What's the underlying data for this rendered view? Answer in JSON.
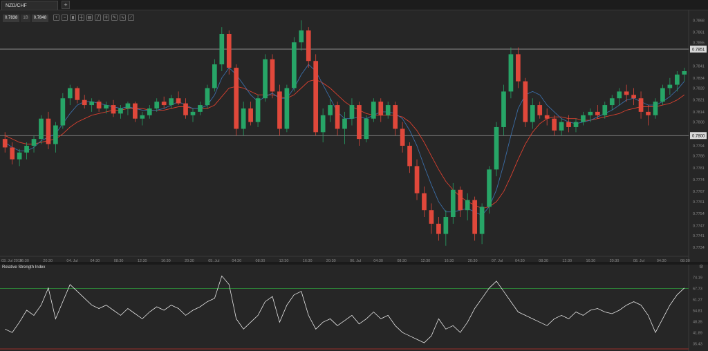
{
  "tab": {
    "label": "NZD/CHF",
    "add_label": "+"
  },
  "quote": {
    "bid": "0.7838",
    "mid": "1B",
    "ask": "0.7848"
  },
  "toolbar": {
    "icons": [
      "zoom-in-icon",
      "zoom-out-icon",
      "candles-icon",
      "ohlc-icon",
      "bars-icon",
      "line-icon",
      "crosshair-icon",
      "pencil-icon",
      "indicator-icon",
      "draw-icon"
    ]
  },
  "rsi": {
    "title": "Relative Strength Index",
    "gear": "⚙"
  },
  "colors": {
    "up": "#27a567",
    "down": "#e0483b",
    "sma_fast": "#3b6ea8",
    "sma_slow": "#d9402f",
    "rsi_line": "#e8e8e8",
    "rsi_upper": "#2e8b3a",
    "rsi_lower": "#c9302c",
    "hline": "#9a9a9a"
  },
  "chart_data": [
    {
      "type": "candlestick",
      "title": "NZD/CHF",
      "ylim": [
        0.773,
        0.7871
      ],
      "y_ticks": [
        "0.7868",
        "0.7861",
        "0.7855",
        "0.7851",
        "0.7841",
        "0.7834",
        "0.7828",
        "0.7821",
        "0.7814",
        "0.7808",
        "0.7800",
        "0.7794",
        "0.7788",
        "0.7781",
        "0.7774",
        "0.7767",
        "0.7761",
        "0.7754",
        "0.7747",
        "0.7741",
        "0.7734"
      ],
      "x_ticks": [
        "03. Jul 2014",
        "16:30",
        "20:30",
        "04. Jul",
        "04:30",
        "08:30",
        "12:30",
        "16:30",
        "20:30",
        "05. Jul",
        "04:30",
        "08:30",
        "12:30",
        "16:30",
        "20:30",
        "06. Jul",
        "04:30",
        "08:30",
        "12:30",
        "16:30",
        "20:30",
        "07. Jul",
        "04:30",
        "08:30",
        "12:30",
        "16:30",
        "20:30",
        "08. Jul",
        "04:30",
        "08:30"
      ],
      "horizontal_lines": [
        {
          "value": 0.7851,
          "label": "0.7851"
        },
        {
          "value": 0.78,
          "label": "0.7800"
        }
      ],
      "candles": [
        [
          0.7798,
          0.7802,
          0.779,
          0.7793
        ],
        [
          0.7793,
          0.7796,
          0.7783,
          0.7786
        ],
        [
          0.7786,
          0.7792,
          0.7782,
          0.779
        ],
        [
          0.779,
          0.7796,
          0.7786,
          0.7794
        ],
        [
          0.7794,
          0.78,
          0.779,
          0.7798
        ],
        [
          0.7798,
          0.7812,
          0.7795,
          0.781
        ],
        [
          0.781,
          0.7814,
          0.7792,
          0.7795
        ],
        [
          0.7795,
          0.7808,
          0.779,
          0.7806
        ],
        [
          0.7806,
          0.7825,
          0.7804,
          0.7822
        ],
        [
          0.7822,
          0.783,
          0.7818,
          0.7828
        ],
        [
          0.7828,
          0.7829,
          0.7819,
          0.7821
        ],
        [
          0.7821,
          0.7824,
          0.7816,
          0.7818
        ],
        [
          0.7818,
          0.7822,
          0.7814,
          0.782
        ],
        [
          0.782,
          0.7821,
          0.7814,
          0.7816
        ],
        [
          0.7816,
          0.782,
          0.7813,
          0.7818
        ],
        [
          0.7818,
          0.7821,
          0.7811,
          0.7813
        ],
        [
          0.7813,
          0.7818,
          0.781,
          0.7816
        ],
        [
          0.7816,
          0.782,
          0.7812,
          0.7819
        ],
        [
          0.7819,
          0.782,
          0.7808,
          0.781
        ],
        [
          0.781,
          0.7814,
          0.7806,
          0.7812
        ],
        [
          0.7812,
          0.7818,
          0.781,
          0.7816
        ],
        [
          0.7816,
          0.7822,
          0.7814,
          0.782
        ],
        [
          0.782,
          0.7823,
          0.7816,
          0.7818
        ],
        [
          0.7818,
          0.7824,
          0.7816,
          0.7822
        ],
        [
          0.7822,
          0.7826,
          0.7818,
          0.7819
        ],
        [
          0.7819,
          0.7822,
          0.781,
          0.7812
        ],
        [
          0.7812,
          0.7816,
          0.7808,
          0.7814
        ],
        [
          0.7814,
          0.782,
          0.7812,
          0.7818
        ],
        [
          0.7818,
          0.783,
          0.7816,
          0.7828
        ],
        [
          0.7828,
          0.7845,
          0.7826,
          0.7842
        ],
        [
          0.7842,
          0.7864,
          0.7838,
          0.786
        ],
        [
          0.786,
          0.7862,
          0.7836,
          0.784
        ],
        [
          0.784,
          0.7842,
          0.78,
          0.7804
        ],
        [
          0.7804,
          0.782,
          0.78,
          0.7816
        ],
        [
          0.7816,
          0.782,
          0.7806,
          0.7808
        ],
        [
          0.7808,
          0.7824,
          0.7805,
          0.7822
        ],
        [
          0.7822,
          0.7848,
          0.782,
          0.7845
        ],
        [
          0.7845,
          0.7848,
          0.7822,
          0.7826
        ],
        [
          0.7826,
          0.783,
          0.78,
          0.7804
        ],
        [
          0.7804,
          0.783,
          0.7802,
          0.7828
        ],
        [
          0.7828,
          0.7858,
          0.7826,
          0.7855
        ],
        [
          0.7855,
          0.7868,
          0.785,
          0.7862
        ],
        [
          0.7862,
          0.7864,
          0.784,
          0.7844
        ],
        [
          0.7844,
          0.7848,
          0.78,
          0.7802
        ],
        [
          0.7802,
          0.7816,
          0.7796,
          0.7812
        ],
        [
          0.7812,
          0.7822,
          0.7808,
          0.7818
        ],
        [
          0.7818,
          0.782,
          0.78,
          0.7804
        ],
        [
          0.7804,
          0.7814,
          0.7795,
          0.781
        ],
        [
          0.781,
          0.7822,
          0.7806,
          0.7818
        ],
        [
          0.7818,
          0.782,
          0.7794,
          0.7798
        ],
        [
          0.7798,
          0.7812,
          0.7796,
          0.781
        ],
        [
          0.781,
          0.7822,
          0.7808,
          0.782
        ],
        [
          0.782,
          0.7822,
          0.7808,
          0.7812
        ],
        [
          0.7812,
          0.782,
          0.781,
          0.7818
        ],
        [
          0.7818,
          0.782,
          0.78,
          0.7804
        ],
        [
          0.7804,
          0.7808,
          0.779,
          0.7794
        ],
        [
          0.7794,
          0.7796,
          0.7778,
          0.7782
        ],
        [
          0.7782,
          0.7786,
          0.7762,
          0.7766
        ],
        [
          0.7766,
          0.777,
          0.7752,
          0.7756
        ],
        [
          0.7756,
          0.776,
          0.7742,
          0.7748
        ],
        [
          0.7748,
          0.7752,
          0.7738,
          0.7742
        ],
        [
          0.7742,
          0.7756,
          0.7735,
          0.7752
        ],
        [
          0.7752,
          0.7772,
          0.7748,
          0.7768
        ],
        [
          0.7768,
          0.777,
          0.7752,
          0.7756
        ],
        [
          0.7756,
          0.7766,
          0.775,
          0.7762
        ],
        [
          0.7762,
          0.7764,
          0.7738,
          0.7742
        ],
        [
          0.7742,
          0.776,
          0.7736,
          0.7758
        ],
        [
          0.7758,
          0.7782,
          0.7754,
          0.778
        ],
        [
          0.778,
          0.7808,
          0.7776,
          0.7805
        ],
        [
          0.7805,
          0.783,
          0.78,
          0.7826
        ],
        [
          0.7826,
          0.7852,
          0.7822,
          0.7848
        ],
        [
          0.7848,
          0.7852,
          0.7828,
          0.7832
        ],
        [
          0.7832,
          0.7834,
          0.7805,
          0.7808
        ],
        [
          0.7808,
          0.7822,
          0.7804,
          0.7818
        ],
        [
          0.7818,
          0.782,
          0.781,
          0.7812
        ],
        [
          0.7812,
          0.7816,
          0.7806,
          0.781
        ],
        [
          0.781,
          0.7812,
          0.78,
          0.7803
        ],
        [
          0.7803,
          0.781,
          0.78,
          0.7808
        ],
        [
          0.7808,
          0.7812,
          0.7802,
          0.7805
        ],
        [
          0.7805,
          0.781,
          0.7802,
          0.7808
        ],
        [
          0.7808,
          0.7814,
          0.7806,
          0.7812
        ],
        [
          0.7812,
          0.7816,
          0.7808,
          0.7814
        ],
        [
          0.7814,
          0.7818,
          0.781,
          0.7812
        ],
        [
          0.7812,
          0.782,
          0.781,
          0.7818
        ],
        [
          0.7818,
          0.7824,
          0.7815,
          0.7822
        ],
        [
          0.7822,
          0.7828,
          0.7818,
          0.7826
        ],
        [
          0.7826,
          0.783,
          0.782,
          0.7824
        ],
        [
          0.7824,
          0.7828,
          0.7818,
          0.7822
        ],
        [
          0.7822,
          0.7826,
          0.781,
          0.7814
        ],
        [
          0.7814,
          0.7818,
          0.7806,
          0.7812
        ],
        [
          0.7812,
          0.7822,
          0.781,
          0.782
        ],
        [
          0.782,
          0.783,
          0.7818,
          0.7828
        ],
        [
          0.7828,
          0.7834,
          0.7824,
          0.783
        ],
        [
          0.783,
          0.7838,
          0.7826,
          0.7836
        ],
        [
          0.7836,
          0.784,
          0.7832,
          0.7838
        ]
      ],
      "sma_fast": [
        0.7796,
        0.7793,
        0.7791,
        0.7791,
        0.7793,
        0.7797,
        0.7799,
        0.7801,
        0.7807,
        0.7813,
        0.7818,
        0.782,
        0.782,
        0.7819,
        0.7818,
        0.7817,
        0.7816,
        0.7817,
        0.7816,
        0.7815,
        0.7815,
        0.7815,
        0.7816,
        0.7818,
        0.782,
        0.7818,
        0.7816,
        0.7816,
        0.7818,
        0.7824,
        0.7834,
        0.784,
        0.7836,
        0.783,
        0.7824,
        0.782,
        0.7823,
        0.7825,
        0.7822,
        0.7822,
        0.7828,
        0.7836,
        0.7842,
        0.7838,
        0.783,
        0.7822,
        0.7814,
        0.781,
        0.781,
        0.7811,
        0.781,
        0.7812,
        0.7814,
        0.7814,
        0.7813,
        0.781,
        0.7803,
        0.7794,
        0.7782,
        0.7771,
        0.7761,
        0.7755,
        0.7755,
        0.7756,
        0.7757,
        0.7755,
        0.7753,
        0.7758,
        0.7768,
        0.7783,
        0.78,
        0.7816,
        0.7824,
        0.7826,
        0.7824,
        0.7818,
        0.7814,
        0.781,
        0.7808,
        0.7807,
        0.7808,
        0.7809,
        0.7811,
        0.7813,
        0.7815,
        0.7818,
        0.7821,
        0.7822,
        0.782,
        0.7818,
        0.7818,
        0.782,
        0.7823,
        0.7827,
        0.7832
      ],
      "sma_slow": [
        0.78,
        0.7798,
        0.7796,
        0.7795,
        0.7795,
        0.7796,
        0.7797,
        0.7798,
        0.7801,
        0.7805,
        0.7808,
        0.781,
        0.7812,
        0.7813,
        0.7814,
        0.7815,
        0.7815,
        0.7816,
        0.7816,
        0.7816,
        0.7815,
        0.7815,
        0.7815,
        0.7816,
        0.7817,
        0.7817,
        0.7816,
        0.7816,
        0.7816,
        0.7818,
        0.7823,
        0.7828,
        0.7829,
        0.7828,
        0.7826,
        0.7824,
        0.7824,
        0.7824,
        0.7823,
        0.7822,
        0.7824,
        0.7828,
        0.7832,
        0.7833,
        0.7831,
        0.7828,
        0.7824,
        0.782,
        0.7817,
        0.7815,
        0.7813,
        0.7812,
        0.7812,
        0.7812,
        0.7812,
        0.7811,
        0.7808,
        0.7803,
        0.7796,
        0.7788,
        0.778,
        0.7773,
        0.7768,
        0.7764,
        0.7761,
        0.7759,
        0.7757,
        0.7758,
        0.7761,
        0.7767,
        0.7776,
        0.7786,
        0.7795,
        0.7802,
        0.7807,
        0.781,
        0.7811,
        0.7811,
        0.781,
        0.781,
        0.7809,
        0.7809,
        0.781,
        0.7811,
        0.7812,
        0.7813,
        0.7815,
        0.7816,
        0.7817,
        0.7817,
        0.7817,
        0.7818,
        0.7819,
        0.7821,
        0.7824
      ]
    },
    {
      "type": "line",
      "title": "Relative Strength Index",
      "ylim": [
        32,
        78
      ],
      "y_ticks": [
        "74.19",
        "67.73",
        "61.27",
        "54.81",
        "48.35",
        "41.89",
        "35.43"
      ],
      "upper_level": 67.73,
      "lower_level": 32.0,
      "values": [
        44,
        42,
        48,
        55,
        52,
        58,
        68,
        50,
        60,
        70,
        66,
        62,
        58,
        56,
        58,
        55,
        52,
        56,
        53,
        50,
        54,
        57,
        55,
        58,
        56,
        52,
        55,
        57,
        60,
        62,
        75,
        70,
        50,
        44,
        48,
        52,
        60,
        63,
        48,
        58,
        64,
        66,
        52,
        44,
        48,
        50,
        46,
        49,
        52,
        47,
        50,
        54,
        50,
        52,
        46,
        42,
        40,
        38,
        36,
        40,
        50,
        44,
        46,
        42,
        48,
        56,
        62,
        68,
        72,
        66,
        60,
        54,
        52,
        50,
        48,
        46,
        50,
        52,
        50,
        54,
        52,
        55,
        56,
        54,
        53,
        55,
        58,
        60,
        58,
        52,
        42,
        50,
        58,
        64,
        68
      ]
    }
  ]
}
